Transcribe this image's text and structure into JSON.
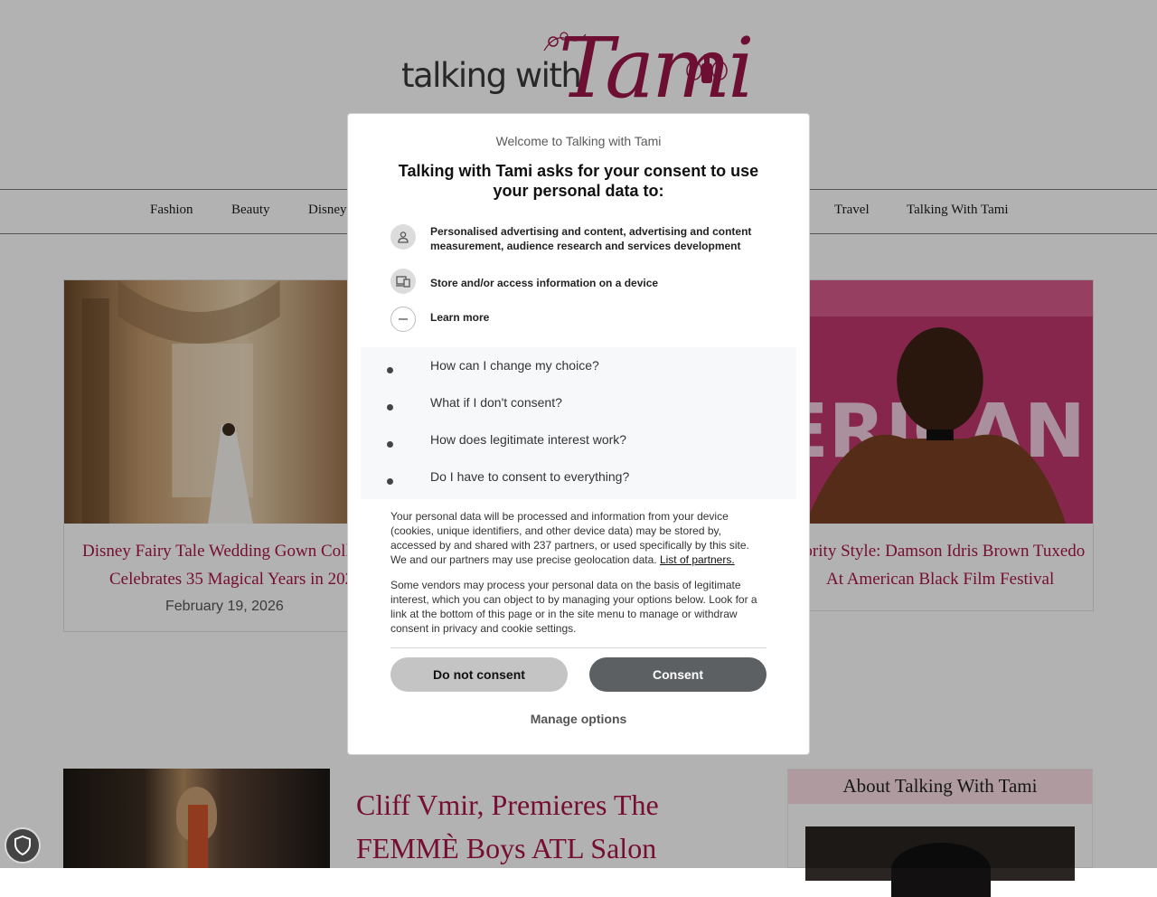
{
  "header": {
    "logo_text_left": "talking with",
    "logo_text_right": "Tami"
  },
  "nav": {
    "items": [
      {
        "label": "Fashion"
      },
      {
        "label": "Beauty"
      },
      {
        "label": "Disney"
      },
      {
        "label": "Travel"
      },
      {
        "label": "Talking With Tami"
      }
    ]
  },
  "cards": [
    {
      "title_line1": "Disney Fairy Tale Wedding Gown Collect",
      "title_line2": "Celebrates 35 Magical Years in 2026",
      "date": "February 19, 2026"
    },
    {
      "title_line1": "ebrity Style: Damson Idris Brown Tuxedo",
      "title_line2": "At American Black Film Festival",
      "date": ""
    }
  ],
  "photo_sign_text": "ERICAN",
  "post": {
    "title_line1": "Cliff Vmir, Premieres The",
    "title_line2": "FEMMÈ Boys ATL Salon"
  },
  "about": {
    "heading": "About Talking With Tami"
  },
  "consent": {
    "brand": "Welcome to Talking with Tami",
    "heading": "Talking with Tami asks for your consent to use your personal data to:",
    "purposes": [
      {
        "icon": "person-icon",
        "label": "Personalised advertising and content, advertising and content measurement, audience research and services development"
      },
      {
        "icon": "device-icon",
        "label": "Store and/or access information on a device"
      },
      {
        "icon": "minus-icon",
        "label": "Learn more"
      }
    ],
    "faq": [
      {
        "question": "How can I change my choice?"
      },
      {
        "question": "What if I don't consent?"
      },
      {
        "question": "How does legitimate interest work?"
      },
      {
        "question": "Do I have to consent to everything?"
      }
    ],
    "body1": "Your personal data will be processed and information from your device (cookies, unique identifiers, and other device data) may be stored by, accessed by and shared with 237 partners, or used specifically by this site. We and our partners may use precise geolocation data.",
    "partners_link": "List of partners.",
    "body2": "Some vendors may process your personal data on the basis of legitimate interest, which you can object to by managing your options below. Look for a link at the bottom of this page or in the site menu to manage or withdraw consent in privacy and cookie settings.",
    "do_not_consent_label": "Do not consent",
    "consent_label": "Consent",
    "manage_label": "Manage options"
  },
  "colors": {
    "brand_pink": "#a9154a",
    "consent_button": "#5d6062",
    "decline_button": "#c4c4c4",
    "about_bar": "#fbdfe4"
  }
}
